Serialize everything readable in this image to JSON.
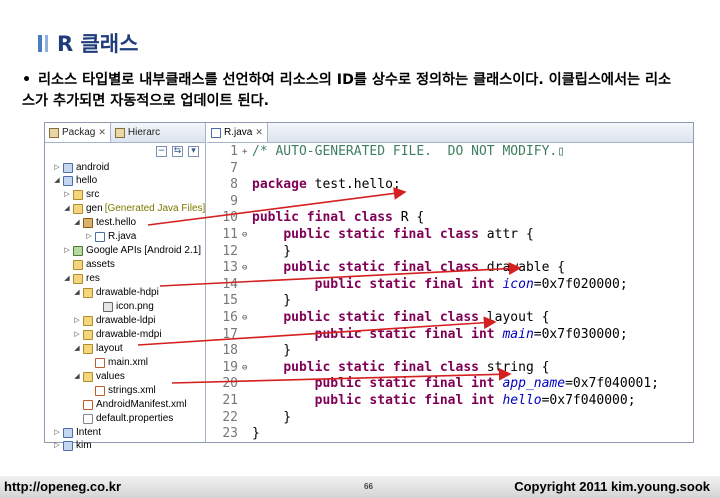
{
  "slide": {
    "title": "R 클래스",
    "bullet": "리소스 타입별로 내부클래스를 선언하여 리소스의 ID를 상수로 정의하는 클래스이다.  이클립스에서는 리소스가 추가되면 자동적으로 업데이트 된다."
  },
  "package_explorer": {
    "tab_label": "Packag",
    "tab2_label": "Hierarc",
    "nodes": [
      {
        "label": "android",
        "icon": "project-icon",
        "tag": ""
      },
      {
        "label": "hello",
        "icon": "project-icon",
        "tag": ""
      },
      {
        "label": "src",
        "icon": "folder-icon",
        "tag": ""
      },
      {
        "label": "gen",
        "icon": "folder-icon",
        "tag": "[Generated Java Files]"
      },
      {
        "label": "test.hello",
        "icon": "package-icon",
        "tag": ""
      },
      {
        "label": "R.java",
        "icon": "java-file-icon",
        "tag": ""
      },
      {
        "label": "Google APIs [Android 2.1]",
        "icon": "library-icon",
        "tag": ""
      },
      {
        "label": "assets",
        "icon": "folder-icon",
        "tag": ""
      },
      {
        "label": "res",
        "icon": "folder-icon",
        "tag": ""
      },
      {
        "label": "drawable-hdpi",
        "icon": "folder-icon",
        "tag": ""
      },
      {
        "label": "icon.png",
        "icon": "image-file-icon",
        "tag": ""
      },
      {
        "label": "drawable-ldpi",
        "icon": "folder-icon",
        "tag": ""
      },
      {
        "label": "drawable-mdpi",
        "icon": "folder-icon",
        "tag": ""
      },
      {
        "label": "layout",
        "icon": "folder-icon",
        "tag": ""
      },
      {
        "label": "main.xml",
        "icon": "xml-file-icon",
        "tag": ""
      },
      {
        "label": "values",
        "icon": "folder-icon",
        "tag": ""
      },
      {
        "label": "strings.xml",
        "icon": "xml-file-icon",
        "tag": ""
      },
      {
        "label": "AndroidManifest.xml",
        "icon": "xml-file-icon",
        "tag": ""
      },
      {
        "label": "default.properties",
        "icon": "file-icon",
        "tag": ""
      },
      {
        "label": "Intent",
        "icon": "project-icon",
        "tag": ""
      },
      {
        "label": "kim",
        "icon": "project-icon",
        "tag": ""
      }
    ]
  },
  "editor": {
    "tab_label": "R.java",
    "lines": [
      {
        "n": "1",
        "mk": "+",
        "segs": [
          {
            "t": "/* AUTO-GENERATED FILE.  DO NOT MODIFY.",
            "c": "cm"
          },
          {
            "t": "▯",
            "c": "cm"
          }
        ]
      },
      {
        "n": "7",
        "mk": "",
        "segs": []
      },
      {
        "n": "8",
        "mk": "",
        "segs": [
          {
            "t": "package",
            "c": "kw"
          },
          {
            "t": " test.hello;",
            "c": "tx"
          }
        ]
      },
      {
        "n": "9",
        "mk": "",
        "segs": []
      },
      {
        "n": "10",
        "mk": "",
        "segs": [
          {
            "t": "public final class",
            "c": "kw"
          },
          {
            "t": " R {",
            "c": "tx"
          }
        ]
      },
      {
        "n": "11",
        "mk": "⊖",
        "segs": [
          {
            "t": "    ",
            "c": "tx"
          },
          {
            "t": "public static final class",
            "c": "kw"
          },
          {
            "t": " attr {",
            "c": "tx"
          }
        ]
      },
      {
        "n": "12",
        "mk": "",
        "segs": [
          {
            "t": "    }",
            "c": "tx"
          }
        ]
      },
      {
        "n": "13",
        "mk": "⊖",
        "segs": [
          {
            "t": "    ",
            "c": "tx"
          },
          {
            "t": "public static final class",
            "c": "kw"
          },
          {
            "t": " drawable {",
            "c": "tx"
          }
        ]
      },
      {
        "n": "14",
        "mk": "",
        "segs": [
          {
            "t": "        ",
            "c": "tx"
          },
          {
            "t": "public static final int",
            "c": "kw"
          },
          {
            "t": " ",
            "c": "tx"
          },
          {
            "t": "icon",
            "c": "fd"
          },
          {
            "t": "=0x7f020000;",
            "c": "tx"
          }
        ]
      },
      {
        "n": "15",
        "mk": "",
        "segs": [
          {
            "t": "    }",
            "c": "tx"
          }
        ]
      },
      {
        "n": "16",
        "mk": "⊖",
        "segs": [
          {
            "t": "    ",
            "c": "tx"
          },
          {
            "t": "public static final class",
            "c": "kw"
          },
          {
            "t": " layout {",
            "c": "tx"
          }
        ]
      },
      {
        "n": "17",
        "mk": "",
        "segs": [
          {
            "t": "        ",
            "c": "tx"
          },
          {
            "t": "public static final int",
            "c": "kw"
          },
          {
            "t": " ",
            "c": "tx"
          },
          {
            "t": "main",
            "c": "fd"
          },
          {
            "t": "=0x7f030000;",
            "c": "tx"
          }
        ]
      },
      {
        "n": "18",
        "mk": "",
        "segs": [
          {
            "t": "    }",
            "c": "tx"
          }
        ]
      },
      {
        "n": "19",
        "mk": "⊖",
        "segs": [
          {
            "t": "    ",
            "c": "tx"
          },
          {
            "t": "public static final class",
            "c": "kw"
          },
          {
            "t": " string {",
            "c": "tx"
          }
        ]
      },
      {
        "n": "20",
        "mk": "",
        "segs": [
          {
            "t": "        ",
            "c": "tx"
          },
          {
            "t": "public static final int",
            "c": "kw"
          },
          {
            "t": " ",
            "c": "tx"
          },
          {
            "t": "app_name",
            "c": "fd"
          },
          {
            "t": "=0x7f040001;",
            "c": "tx"
          }
        ]
      },
      {
        "n": "21",
        "mk": "",
        "segs": [
          {
            "t": "        ",
            "c": "tx"
          },
          {
            "t": "public static final int",
            "c": "kw"
          },
          {
            "t": " ",
            "c": "tx"
          },
          {
            "t": "hello",
            "c": "fd"
          },
          {
            "t": "=0x7f040000;",
            "c": "tx"
          }
        ]
      },
      {
        "n": "22",
        "mk": "",
        "segs": [
          {
            "t": "    }",
            "c": "tx"
          }
        ]
      },
      {
        "n": "23",
        "mk": "",
        "segs": [
          {
            "t": "}",
            "c": "tx"
          }
        ]
      }
    ]
  },
  "footer": {
    "left": "http://openeg.co.kr",
    "page": "66",
    "right": "Copyright  2011 kim.young.sook"
  },
  "colors": {
    "accent": "#4a7cc0",
    "title": "#1f3d7a",
    "arrow": "#d42020",
    "keyword": "#7f0055",
    "comment": "#3f7f5f",
    "field": "#0000c0"
  }
}
